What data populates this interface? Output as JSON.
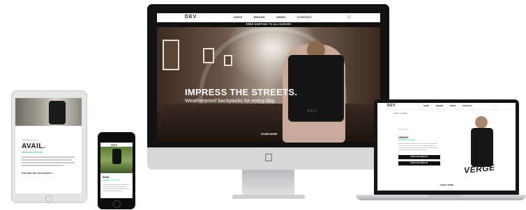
{
  "imac": {
    "logo": "DEV",
    "nav": [
      "SHOP",
      "BRAND",
      "NEWS",
      "CONTACT"
    ],
    "cart_icon": "cart-icon",
    "banner": "FREE SHIPPING TO ALL EUROPE",
    "hero_title": "IMPRESS THE STREETS.",
    "hero_subtitle": "Weatherproof backpacks for every day.",
    "hero_cta": "LEARN MORE",
    "bag_logo": "DEV",
    "apple_icon": "apple-icon"
  },
  "tablet": {
    "small_text": "COLLECTION 01",
    "title": "AVAIL.",
    "teal_text": "CONTROL & GOODS",
    "link": "EXPLORE THE COLLECTION 1"
  },
  "phone": {
    "logo": "DEV",
    "title": "AVAIL",
    "teal_text": "CONTROL & GOODS"
  },
  "laptop": {
    "logo": "DEV",
    "nav": [
      "SHOP",
      "BRAND",
      "NEWS",
      "CONTACT"
    ],
    "breadcrumb": "< BACK TO SHOP",
    "small_text": "BACKPACK",
    "title": "VERGE.",
    "teal_text": "CONTROL & GOODS",
    "button1": "SHOP THE VERGE 01",
    "button2": "SHOP THE VERGE 02",
    "verge_text": "VERGE",
    "scroll": "SCROLL DOWN"
  },
  "colors": {
    "accent": "#2bb5a8",
    "dark": "#111111"
  }
}
